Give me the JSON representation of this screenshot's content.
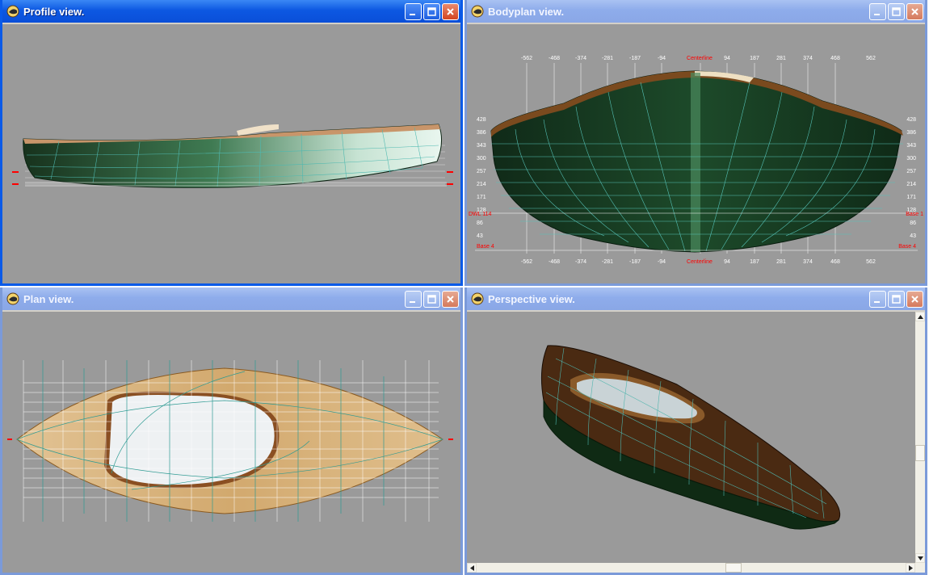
{
  "windows": {
    "profile": {
      "title": "Profile view."
    },
    "bodyplan": {
      "title": "Bodyplan view."
    },
    "plan": {
      "title": "Plan view."
    },
    "perspective": {
      "title": "Perspective view."
    }
  },
  "bodyplan": {
    "top_ticks_left": [
      "-562",
      "-468",
      "-374",
      "-281",
      "-187",
      "-94"
    ],
    "centerline_label": "Centerline",
    "top_ticks_right": [
      "94",
      "187",
      "281",
      "374",
      "468",
      "562"
    ],
    "height_ticks": [
      "428",
      "386",
      "343",
      "300",
      "257",
      "214",
      "171",
      "128",
      "86",
      "43"
    ],
    "dwl_label_left": "DWL 114",
    "dwl_label_right": "Base 1",
    "base_label": "Base 4"
  },
  "colors": {
    "active_title": "#0a5ae8",
    "inactive_title": "#8eaceb",
    "viewport_bg": "#9a9a9a",
    "grid": "#ffffff",
    "marker": "#ff0000",
    "hull_green": "#1e4d2a",
    "deck_tan": "#d8b27c",
    "wood": "#7a4a1e"
  },
  "icons": {
    "app": "app-icon",
    "minimize": "minimize-icon",
    "maximize": "maximize-icon",
    "close": "close-icon"
  }
}
